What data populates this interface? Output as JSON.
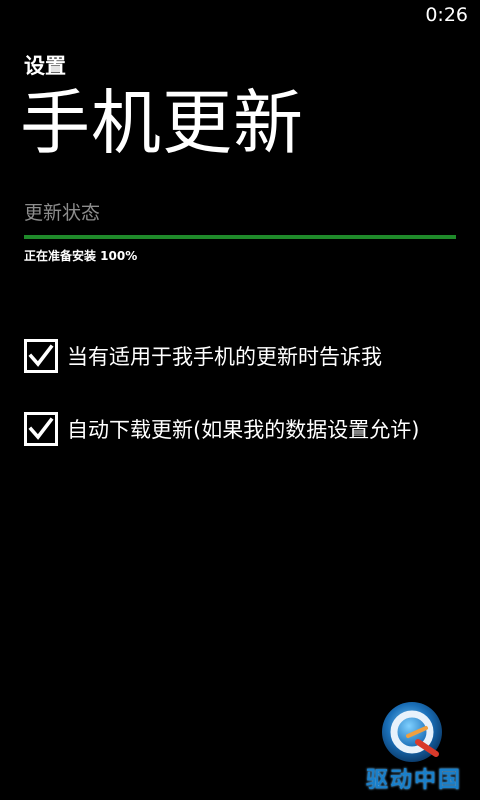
{
  "status_bar": {
    "time": "0:26"
  },
  "header": {
    "app_title": "设置",
    "page_title": "手机更新"
  },
  "update_status": {
    "label": "更新状态",
    "progress_text": "正在准备安装 100%",
    "progress_percent": 100,
    "progress_color": "#1f8a2a"
  },
  "options": [
    {
      "label": "当有适用于我手机的更新时告诉我",
      "checked": true
    },
    {
      "label": "自动下载更新(如果我的数据设置允许)",
      "checked": true
    }
  ],
  "watermark": {
    "text": "驱动中国"
  }
}
